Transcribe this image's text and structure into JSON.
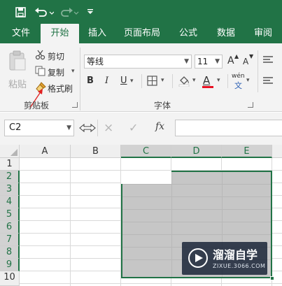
{
  "quick_access": {
    "save_icon": "save-icon",
    "undo_icon": "undo-icon",
    "redo_icon": "redo-icon",
    "customize_icon": "customize-icon"
  },
  "tabs": [
    {
      "label": "文件"
    },
    {
      "label": "开始"
    },
    {
      "label": "插入"
    },
    {
      "label": "页面布局"
    },
    {
      "label": "公式"
    },
    {
      "label": "数据"
    },
    {
      "label": "审阅"
    }
  ],
  "active_tab": "开始",
  "clipboard": {
    "paste_label": "粘贴",
    "cut_label": "剪切",
    "copy_label": "复制",
    "format_painter_label": "格式刷",
    "group_label": "剪贴板"
  },
  "font": {
    "name": "等线",
    "size": "11",
    "bold": "B",
    "italic": "I",
    "underline": "U",
    "grow": "A",
    "shrink": "A",
    "phonetic_top": "wén",
    "phonetic_bottom": "文",
    "font_color_glyph": "A",
    "group_label": "字体"
  },
  "formula_bar": {
    "name_box": "C2",
    "cancel_icon": "×",
    "enter_icon": "✓",
    "fx": "fx",
    "content": ""
  },
  "sheet": {
    "columns": [
      "A",
      "B",
      "C",
      "D",
      "E"
    ],
    "rows": [
      "1",
      "2",
      "3",
      "4",
      "5",
      "6",
      "7",
      "8",
      "9",
      "10"
    ],
    "active_cell": "C2",
    "selection": "C2:E9"
  },
  "watermark": {
    "title": "溜溜自学",
    "url": "ZIXUE.3066.COM"
  },
  "colors": {
    "brand": "#217346",
    "selection_fill": "#c6c6c6",
    "font_color": "#e81123"
  }
}
